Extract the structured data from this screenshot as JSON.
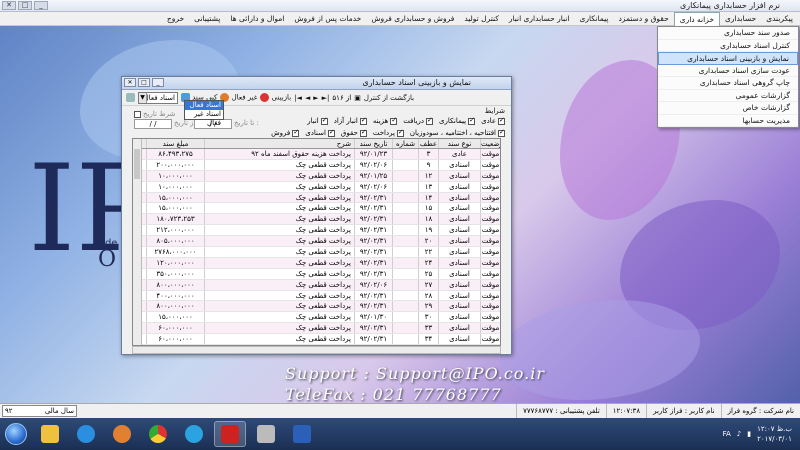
{
  "window": {
    "title": "نرم افزار حسابداری پیمانکاری"
  },
  "menu": [
    "پیکربندی",
    "حسابداری",
    "خزانه داری",
    "حقوق و دستمزد",
    "پیمانکاری",
    "انبار حسابداری انبار",
    "کنترل تولید",
    "فروش و حسابداری فروش",
    "خدمات پس از فروش",
    "اموال و دارائی ها",
    "پشتیبانی",
    "خروج"
  ],
  "dropdown": [
    "صدور سند حسابداری",
    "کنترل اسناد حسابداری",
    "نمایش و بازبینی اسناد حسابداری",
    "عودت سازی اسناد حسابداری",
    "چاپ گروهی اسناد حسابداری",
    "گزارشات عمومی",
    "گزارشات خاص",
    "مدیریت حسابها"
  ],
  "dropdown_selected_index": 2,
  "logo": {
    "letters": "IPO",
    "small1": "Ide",
    "small2": "O"
  },
  "support": "Support : Support@IPO.co.ir",
  "telefax": "TeleFax : 021 77768777",
  "dialog": {
    "title": "نمایش و بازبینی اسناد حسابداری",
    "combo_value": "اسناد فعال",
    "combo_options": [
      "اسناد فعال",
      "اسناد غیر فعال"
    ],
    "btn_refresh": "بازبینی",
    "btn_inactive": "غیر فعال",
    "btn_copy": "کپی سند",
    "nav_of": "از ۵۱۶",
    "btn_return": "بازگشت از کنترل",
    "filter_header": "شرایط",
    "filter_row1": [
      "عادی",
      "پیمانکاری",
      "دریافت",
      "هزینه",
      "انبار آزاد",
      "انبار"
    ],
    "filter_row2": [
      "افتتاحیه ، اختتامیه ، سودوزیان",
      "پرداخت",
      "حقوق",
      "اسنادی",
      "فروش"
    ],
    "filter_extra": "شرط تاریخ",
    "from_date_label": "از تاریخ :",
    "to_date_label": "تا تاریخ :",
    "date_placeholder": "/ /"
  },
  "grid": {
    "headers": [
      "وضعیت",
      "نوع سند",
      "عطف",
      "شماره",
      "تاریخ سند",
      "شرح",
      "مبلغ سند"
    ],
    "rows": [
      [
        "موقت",
        "عادی",
        "۳",
        "",
        "۹۲/۰۱/۲۳",
        "پرداخت هزینه حقوق اسفند ماه ۹۲",
        "۸۶،۴۹۳،۲۷۵"
      ],
      [
        "موقت",
        "اسنادی",
        "۹",
        "",
        "۹۲/۰۲/۰۶",
        "پرداخت قطعی چک",
        "۲۰۰،۰۰۰،۰۰۰"
      ],
      [
        "موقت",
        "اسنادی",
        "۱۲",
        "",
        "۹۲/۰۱/۲۵",
        "پرداخت قطعی چک",
        "۱۰،۰۰۰،۰۰۰"
      ],
      [
        "موقت",
        "اسنادی",
        "۱۳",
        "",
        "۹۲/۰۲/۰۶",
        "پرداخت قطعی چک",
        "۱۰،۰۰۰،۰۰۰"
      ],
      [
        "موقت",
        "اسنادی",
        "۱۴",
        "",
        "۹۲/۰۲/۳۱",
        "پرداخت قطعی چک",
        "۱۵،۰۰۰،۰۰۰"
      ],
      [
        "موقت",
        "اسنادی",
        "۱۵",
        "",
        "۹۲/۰۲/۳۱",
        "پرداخت قطعی چک",
        "۱۵،۰۰۰،۰۰۰"
      ],
      [
        "موقت",
        "اسنادی",
        "۱۸",
        "",
        "۹۲/۰۲/۳۱",
        "پرداخت قطعی چک",
        "۱۸۰،۷۲۳،۲۵۳"
      ],
      [
        "موقت",
        "اسنادی",
        "۱۹",
        "",
        "۹۲/۰۲/۳۱",
        "پرداخت قطعی چک",
        "۲۱۲،۰۰۰،۰۰۰"
      ],
      [
        "موقت",
        "اسنادی",
        "۲۰",
        "",
        "۹۲/۰۲/۳۱",
        "پرداخت قطعی چک",
        "۸۰۵،۰۰۰،۰۰۰"
      ],
      [
        "موقت",
        "اسنادی",
        "۲۲",
        "",
        "۹۲/۰۲/۳۱",
        "پرداخت قطعی چک",
        "۲۷۶۸،۰۰۰،۰۰۰"
      ],
      [
        "موقت",
        "اسنادی",
        "۲۴",
        "",
        "۹۲/۰۲/۳۱",
        "پرداخت قطعی چک",
        "۱۲۰،۰۰۰،۰۰۰"
      ],
      [
        "موقت",
        "اسنادی",
        "۲۵",
        "",
        "۹۲/۰۲/۳۱",
        "پرداخت قطعی چک",
        "۳۵۰،۰۰۰،۰۰۰"
      ],
      [
        "موقت",
        "اسنادی",
        "۲۷",
        "",
        "۹۲/۰۲/۰۶",
        "پرداخت قطعی چک",
        "۸۰۰،۰۰۰،۰۰۰"
      ],
      [
        "موقت",
        "اسنادی",
        "۲۸",
        "",
        "۹۲/۰۲/۳۱",
        "پرداخت قطعی چک",
        "۴۰۰،۰۰۰،۰۰۰"
      ],
      [
        "موقت",
        "اسنادی",
        "۲۹",
        "",
        "۹۲/۰۲/۳۱",
        "پرداخت قطعی چک",
        "۸۰۰،۰۰۰،۰۰۰"
      ],
      [
        "موقت",
        "اسنادی",
        "۳۰",
        "",
        "۹۲/۰۱/۳۰",
        "پرداخت قطعی چک",
        "۱۵،۰۰۰،۰۰۰"
      ],
      [
        "موقت",
        "اسنادی",
        "۳۳",
        "",
        "۹۲/۰۲/۳۱",
        "پرداخت قطعی چک",
        "۶۰،۰۰۰،۰۰۰"
      ],
      [
        "موقت",
        "اسنادی",
        "۳۴",
        "",
        "۹۲/۰۲/۳۱",
        "پرداخت قطعی چک",
        "۶۰،۰۰۰،۰۰۰"
      ],
      [
        "موقت",
        "اسنادی",
        "۳۵",
        "",
        "۹۲/۰۲/۲۶",
        "پرداخت قطعی چک",
        "۱۶،۷۵۲،۰۰۰"
      ],
      [
        "موقت",
        "عادی",
        "۴۱",
        "",
        "۹۲/۰۲/۳۰",
        "بابت ثبت صورت وضعیت شماره ۷ه۹",
        "۶۰۸،۴۳۳،۵۹۷"
      ],
      [
        "موقت",
        "عادی",
        "۴۲",
        "",
        "۹۲/۰۲/۳۰",
        "بابت ثبت صورت وضعیت شماره یک تا سه قرارداد گلنجین",
        "۲،۳۴۵،۰۷۹،۵۲۰"
      ]
    ]
  },
  "statusbar": [
    "نام شرکت : گروه فراز",
    "نام کاربر : فراز کاربر",
    "۱۲:۰۷:۳۸",
    "تلفن پشتیبانی : ۷۷۷۶۸۷۷۷"
  ],
  "year": {
    "label": "سال مالی",
    "value": "۹۲"
  },
  "tray": {
    "lang": "FA",
    "time": "۱۲:۰۷ ب.ظ",
    "date": "۲۰۱۷/۰۳/۰۱"
  },
  "colors": {
    "menu_active": "#ffffff",
    "selection": "#cfe3fb",
    "taskbar": "#1b2f52"
  }
}
